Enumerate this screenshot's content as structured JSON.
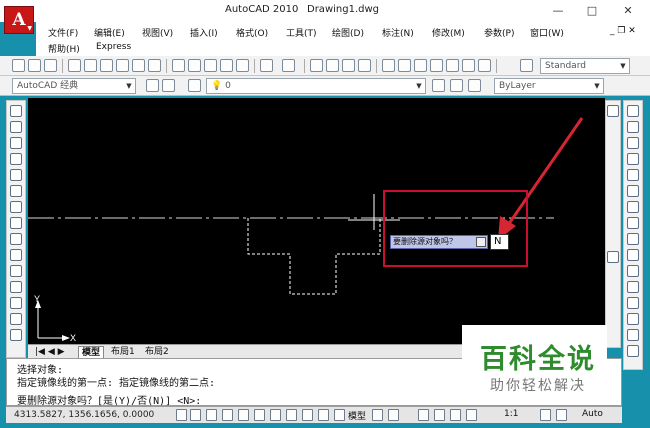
{
  "window": {
    "app_name": "AutoCAD 2010",
    "document": "Drawing1.dwg",
    "app_button_letter": "A",
    "controls": {
      "minimize": "—",
      "maximize": "□",
      "close": "✕"
    },
    "doc_controls": "_ ❐ ✕"
  },
  "menu": {
    "row1": [
      "文件(F)",
      "编辑(E)",
      "视图(V)",
      "插入(I)",
      "格式(O)",
      "工具(T)",
      "绘图(D)",
      "标注(N)",
      "修改(M)",
      "参数(P)",
      "窗口(W)"
    ],
    "row2": [
      "帮助(H)",
      "Express"
    ]
  },
  "toolbar": {
    "text_style": "Standard",
    "workspace": "AutoCAD 经典",
    "layer": "0",
    "linetype": "ByLayer"
  },
  "canvas": {
    "prompt_text": "要删除源对象吗？",
    "input_value": "N",
    "ucs_x": "X",
    "ucs_y": "Y",
    "colors": {
      "background": "#000000",
      "highlight": "#c8102e",
      "prompt_bg": "#bfc6e8"
    }
  },
  "layout_tabs": [
    "模型",
    "布局1",
    "布局2"
  ],
  "command": {
    "line1": "选择对象:",
    "line2": "指定镜像线的第一点: 指定镜像线的第二点:",
    "line3": "要删除源对象吗？[是(Y)/否(N)] <N>:"
  },
  "status": {
    "coords": "4313.5827, 1356.1656, 0.0000",
    "model": "模型",
    "scale": "1:1",
    "auto": "Auto"
  },
  "watermark": {
    "title": "百科全说",
    "subtitle": "助你轻松解决"
  }
}
